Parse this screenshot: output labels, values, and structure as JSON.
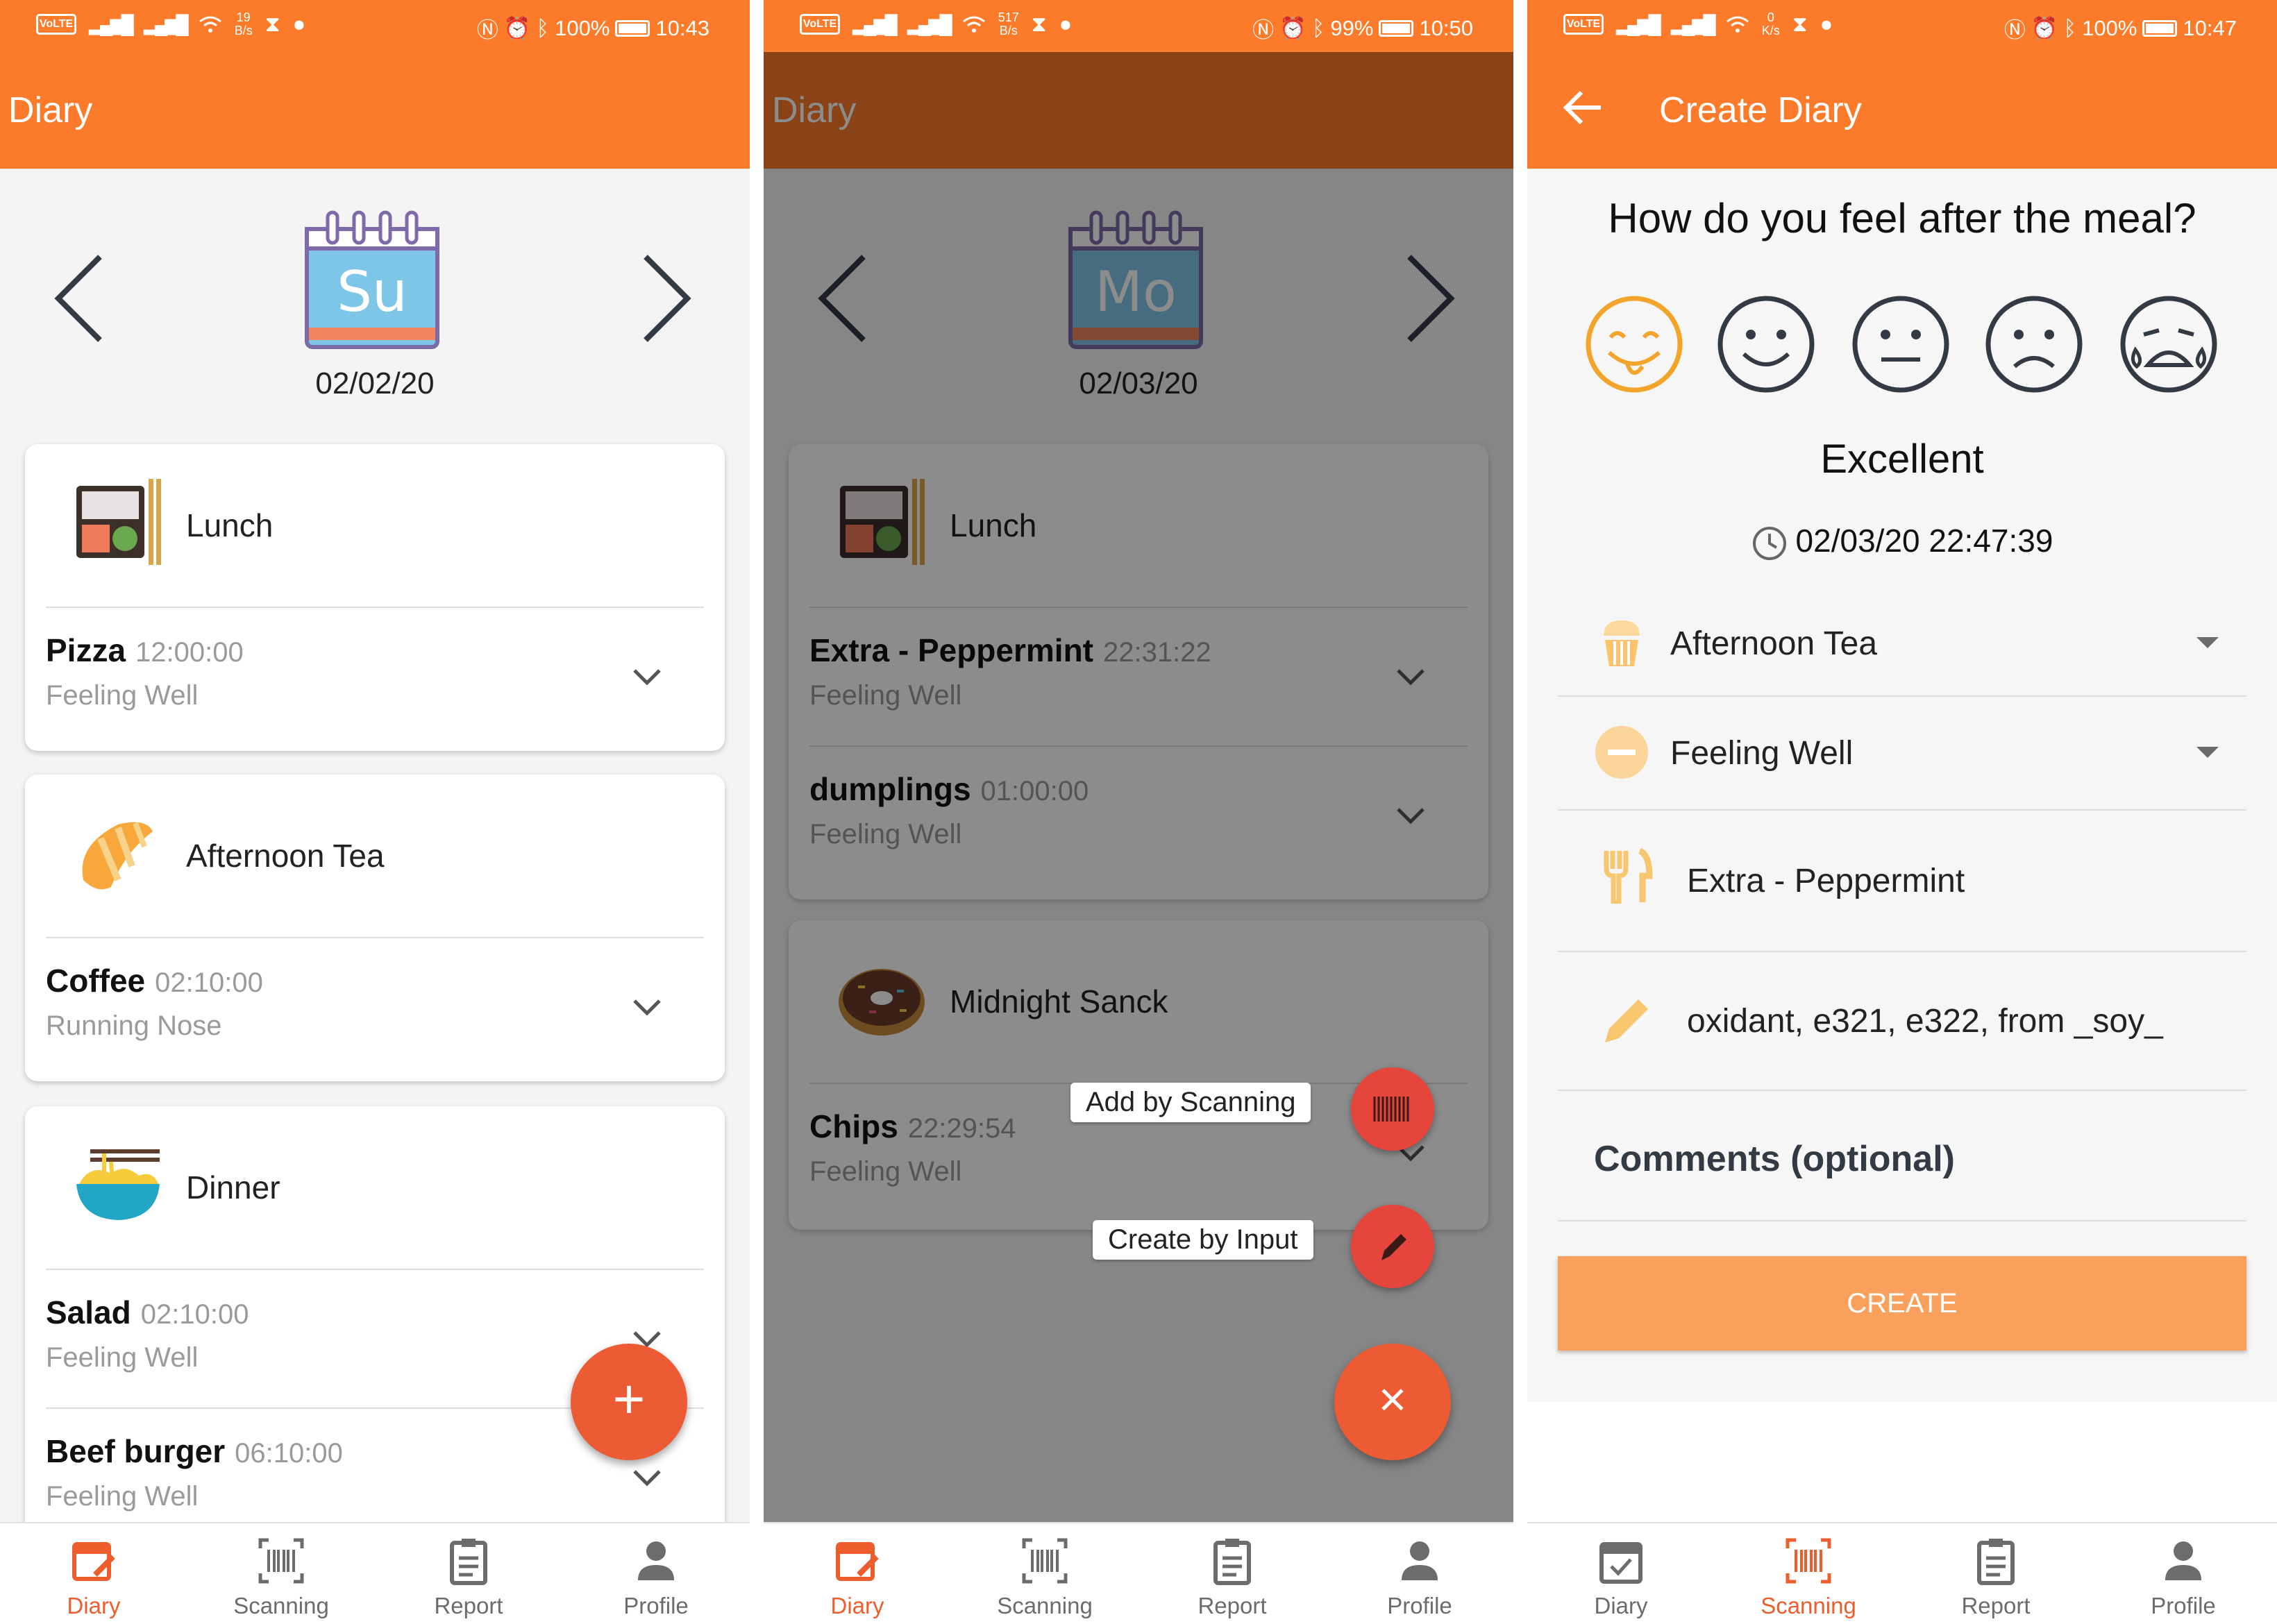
{
  "colors": {
    "primary": "#fc7b2b",
    "fab": "#ec5b33",
    "active_nav": "#ee5d2c",
    "create_button": "#f9a05c"
  },
  "nav_items": [
    "Diary",
    "Scanning",
    "Report",
    "Profile"
  ],
  "screen1": {
    "status": {
      "speed_value": "19",
      "speed_unit": "B/s",
      "battery": "100%",
      "time": "10:43"
    },
    "title": "Diary",
    "calendar_day": "Su",
    "date": "02/02/20",
    "meals": [
      {
        "title": "Lunch",
        "icon": "bento-box-icon",
        "entries": [
          {
            "name": "Pizza",
            "time": "12:00:00",
            "feeling": "Feeling Well"
          }
        ]
      },
      {
        "title": "Afternoon Tea",
        "icon": "croissant-icon",
        "entries": [
          {
            "name": "Coffee",
            "time": "02:10:00",
            "feeling": "Running Nose"
          }
        ]
      },
      {
        "title": "Dinner",
        "icon": "noodle-bowl-icon",
        "entries": [
          {
            "name": "Salad",
            "time": "02:10:00",
            "feeling": "Feeling Well"
          },
          {
            "name": "Beef burger",
            "time": "06:10:00",
            "feeling": "Feeling Well"
          }
        ]
      }
    ],
    "fab_symbol": "+",
    "active_nav": "Diary"
  },
  "screen2": {
    "status": {
      "speed_value": "517",
      "speed_unit": "B/s",
      "battery": "99%",
      "time": "10:50"
    },
    "title": "Diary",
    "calendar_day": "Mo",
    "date": "02/03/20",
    "meals": [
      {
        "title": "Lunch",
        "icon": "bento-box-icon",
        "entries": [
          {
            "name": "Extra - Peppermint",
            "time": "22:31:22",
            "feeling": "Feeling Well"
          },
          {
            "name": "dumplings",
            "time": "01:00:00",
            "feeling": "Feeling Well"
          }
        ]
      },
      {
        "title": "Midnight Sanck",
        "icon": "donut-icon",
        "entries": [
          {
            "name": "Chips",
            "time": "22:29:54",
            "feeling": "Feeling Well"
          }
        ]
      }
    ],
    "fab_actions": {
      "scan": "Add by Scanning",
      "input": "Create by Input"
    },
    "fab_symbol": "×",
    "active_nav": "Diary"
  },
  "screen3": {
    "status": {
      "speed_value": "0",
      "speed_unit": "K/s",
      "battery": "100%",
      "time": "10:47"
    },
    "title": "Create Diary",
    "question": "How do you feel after the meal?",
    "moods": [
      "Excellent",
      "Good",
      "Neutral",
      "Sad",
      "Crying"
    ],
    "selected_mood": "Excellent",
    "timestamp": "02/03/20 22:47:39",
    "meal_type": "Afternoon Tea",
    "feeling": "Feeling Well",
    "food": "Extra - Peppermint",
    "ingredients": "oxidant, e321, e322, from _soy_",
    "comments_label": "Comments (optional)",
    "create_label": "CREATE",
    "active_nav": "Scanning"
  }
}
